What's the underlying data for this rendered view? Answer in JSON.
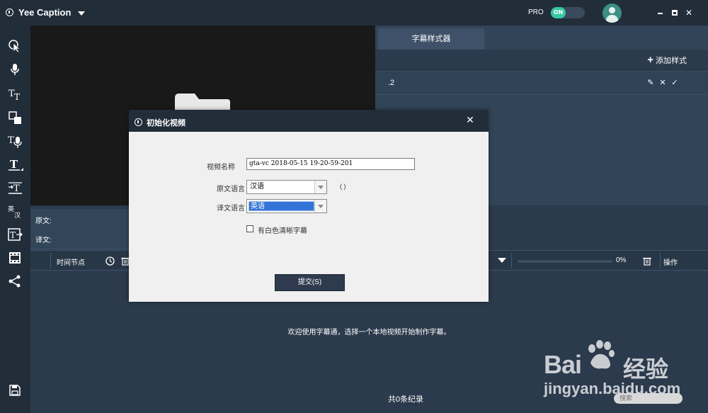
{
  "app": {
    "title": "Yee Caption",
    "pro_label": "PRO",
    "pro_toggle_state": "ON"
  },
  "style_panel": {
    "tab_label": "字幕样式器",
    "add_style_label": "添加样式",
    "styles": [
      {
        "name": ".2"
      }
    ]
  },
  "editor": {
    "source_label": "原文:",
    "translation_label": "译文:"
  },
  "timeline": {
    "time_node_label": "时间节点",
    "progress_text": "0%",
    "progress_value": 0,
    "actions_label": "操作"
  },
  "content": {
    "welcome_text": "欢迎使用字幕通，选择一个本地视频开始制作字幕。",
    "record_count": "共0条纪录",
    "search_placeholder": "搜索"
  },
  "watermark": {
    "bai": "Bai",
    "jingyan_cn": "经验",
    "url": "jingyan.baidu.com"
  },
  "dialog": {
    "title": "初始化视频",
    "video_name_label": "视频名称",
    "video_name_value": "gta-vc 2018-05-15 19-20-59-201",
    "source_language_label": "原文语言",
    "source_language_value": "汉语",
    "source_language_note": "( )",
    "target_language_label": "译文语言",
    "target_language_value": "英语",
    "white_subtitle_label": "有白色清晰字幕",
    "white_subtitle_checked": false,
    "submit_label": "提交(S)"
  },
  "icons": {
    "toolbar": [
      "select-pointer-icon",
      "microphone-icon",
      "text-size-icon",
      "shape-icon",
      "text-voice-icon",
      "text-box-icon",
      "text-import-icon",
      "translate-icon",
      "text-export-icon",
      "filmstrip-icon",
      "share-icon",
      "save-icon"
    ],
    "accent_color": "#37c7a3",
    "selection_color": "#3375d6"
  }
}
